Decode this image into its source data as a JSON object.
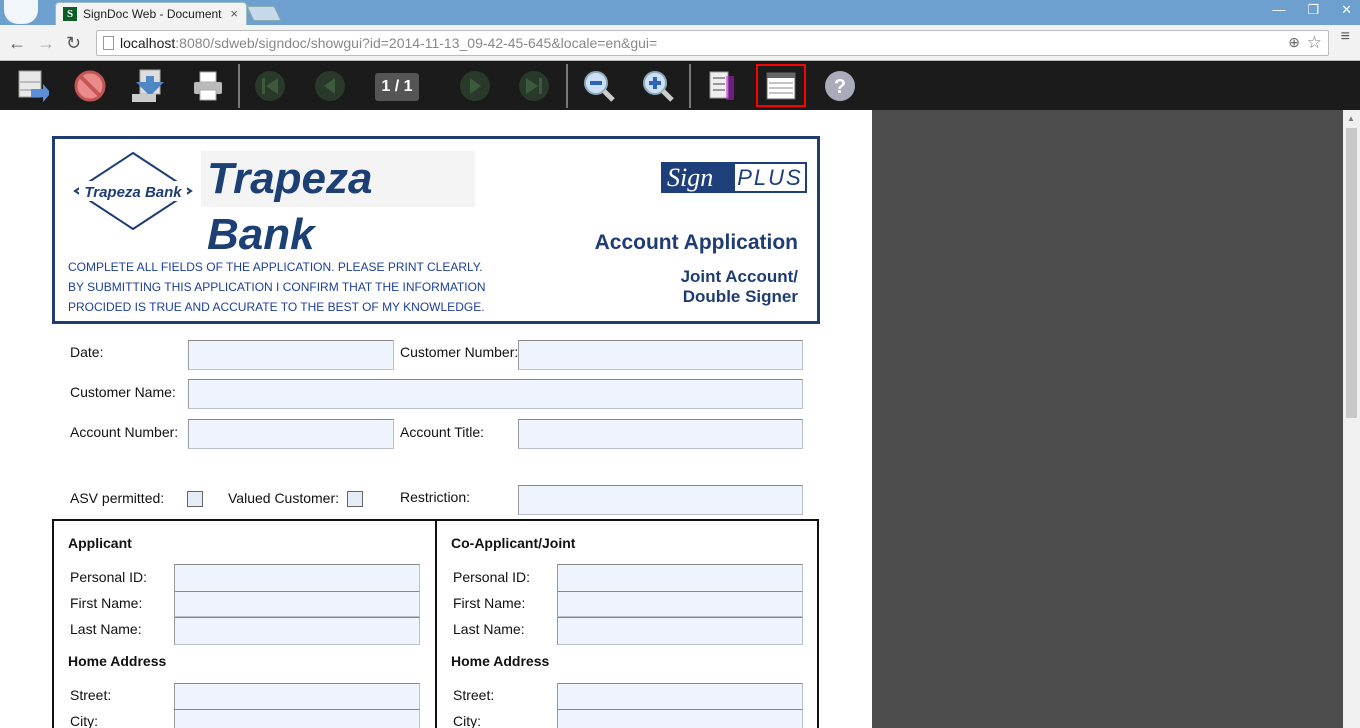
{
  "browser": {
    "tab_title": "SignDoc Web - Document",
    "tab_favicon": "S",
    "close_tab": "×",
    "url_host": "localhost",
    "url_rest": ":8080/sdweb/signdoc/showgui?id=2014-11-13_09-42-45-645&locale=en&gui=",
    "window_min": "—",
    "window_restore": "❐",
    "window_close": "✕"
  },
  "nav": {
    "back": "←",
    "forward": "→",
    "reload": "↻",
    "zoom": "⊕",
    "star": "☆",
    "menu": "≡"
  },
  "app_toolbar": {
    "page_indicator": "1 / 1",
    "buttons": [
      "save-icon",
      "cancel-icon",
      "download-icon",
      "print-icon",
      "first-page-icon",
      "previous-page-icon",
      "next-page-icon",
      "last-page-icon",
      "zoom-out-icon",
      "zoom-in-icon",
      "fit-width-icon",
      "form-view-icon",
      "help-icon"
    ],
    "accent": "#ff0000"
  },
  "header": {
    "logo_text": "Trapeza Bank",
    "bank_name": "Trapeza Bank",
    "signplus_a": "Sign",
    "signplus_b": "PLUS",
    "instructions": "COMPLETE ALL FIELDS OF THE APPLICATION. PLEASE PRINT CLEARLY. BY SUBMITTING THIS APPLICATION I CONFIRM THAT THE INFORMATION PROCIDED IS TRUE AND ACCURATE TO THE BEST OF MY KNOWLEDGE.",
    "title": "Account Application",
    "subtitle_line1": "Joint Account/",
    "subtitle_line2": "Double Signer"
  },
  "form": {
    "date": "Date:",
    "customer_number": "Customer Number:",
    "customer_name": "Customer Name:",
    "account_number": "Account Number:",
    "account_title": "Account Title:",
    "asv": "ASV permitted:",
    "valued": "Valued Customer:",
    "restriction": "Restriction:"
  },
  "applicant": {
    "title": "Applicant",
    "personal_id": "Personal ID:",
    "first_name": "First Name:",
    "last_name": "Last Name:",
    "home_address": "Home Address",
    "street": "Street:",
    "city": "City:"
  },
  "coapplicant": {
    "title": "Co-Applicant/Joint",
    "personal_id": "Personal ID:",
    "first_name": "First Name:",
    "last_name": "Last Name:",
    "home_address": "Home Address",
    "street": "Street:",
    "city": "City:"
  }
}
